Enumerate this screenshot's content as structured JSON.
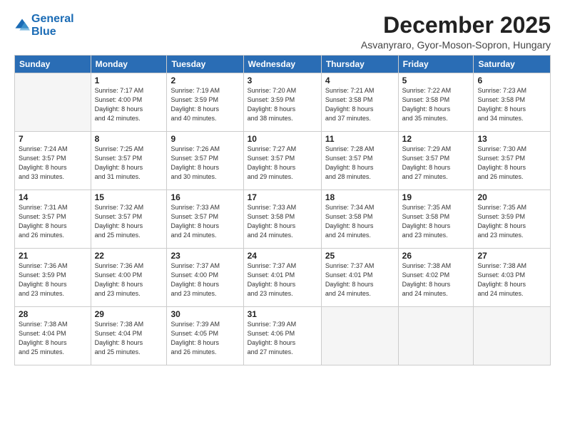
{
  "logo": {
    "line1": "General",
    "line2": "Blue"
  },
  "title": "December 2025",
  "location": "Asvanyraro, Gyor-Moson-Sopron, Hungary",
  "weekdays": [
    "Sunday",
    "Monday",
    "Tuesday",
    "Wednesday",
    "Thursday",
    "Friday",
    "Saturday"
  ],
  "weeks": [
    [
      {
        "day": "",
        "info": ""
      },
      {
        "day": "1",
        "info": "Sunrise: 7:17 AM\nSunset: 4:00 PM\nDaylight: 8 hours\nand 42 minutes."
      },
      {
        "day": "2",
        "info": "Sunrise: 7:19 AM\nSunset: 3:59 PM\nDaylight: 8 hours\nand 40 minutes."
      },
      {
        "day": "3",
        "info": "Sunrise: 7:20 AM\nSunset: 3:59 PM\nDaylight: 8 hours\nand 38 minutes."
      },
      {
        "day": "4",
        "info": "Sunrise: 7:21 AM\nSunset: 3:58 PM\nDaylight: 8 hours\nand 37 minutes."
      },
      {
        "day": "5",
        "info": "Sunrise: 7:22 AM\nSunset: 3:58 PM\nDaylight: 8 hours\nand 35 minutes."
      },
      {
        "day": "6",
        "info": "Sunrise: 7:23 AM\nSunset: 3:58 PM\nDaylight: 8 hours\nand 34 minutes."
      }
    ],
    [
      {
        "day": "7",
        "info": "Sunrise: 7:24 AM\nSunset: 3:57 PM\nDaylight: 8 hours\nand 33 minutes."
      },
      {
        "day": "8",
        "info": "Sunrise: 7:25 AM\nSunset: 3:57 PM\nDaylight: 8 hours\nand 31 minutes."
      },
      {
        "day": "9",
        "info": "Sunrise: 7:26 AM\nSunset: 3:57 PM\nDaylight: 8 hours\nand 30 minutes."
      },
      {
        "day": "10",
        "info": "Sunrise: 7:27 AM\nSunset: 3:57 PM\nDaylight: 8 hours\nand 29 minutes."
      },
      {
        "day": "11",
        "info": "Sunrise: 7:28 AM\nSunset: 3:57 PM\nDaylight: 8 hours\nand 28 minutes."
      },
      {
        "day": "12",
        "info": "Sunrise: 7:29 AM\nSunset: 3:57 PM\nDaylight: 8 hours\nand 27 minutes."
      },
      {
        "day": "13",
        "info": "Sunrise: 7:30 AM\nSunset: 3:57 PM\nDaylight: 8 hours\nand 26 minutes."
      }
    ],
    [
      {
        "day": "14",
        "info": "Sunrise: 7:31 AM\nSunset: 3:57 PM\nDaylight: 8 hours\nand 26 minutes."
      },
      {
        "day": "15",
        "info": "Sunrise: 7:32 AM\nSunset: 3:57 PM\nDaylight: 8 hours\nand 25 minutes."
      },
      {
        "day": "16",
        "info": "Sunrise: 7:33 AM\nSunset: 3:57 PM\nDaylight: 8 hours\nand 24 minutes."
      },
      {
        "day": "17",
        "info": "Sunrise: 7:33 AM\nSunset: 3:58 PM\nDaylight: 8 hours\nand 24 minutes."
      },
      {
        "day": "18",
        "info": "Sunrise: 7:34 AM\nSunset: 3:58 PM\nDaylight: 8 hours\nand 24 minutes."
      },
      {
        "day": "19",
        "info": "Sunrise: 7:35 AM\nSunset: 3:58 PM\nDaylight: 8 hours\nand 23 minutes."
      },
      {
        "day": "20",
        "info": "Sunrise: 7:35 AM\nSunset: 3:59 PM\nDaylight: 8 hours\nand 23 minutes."
      }
    ],
    [
      {
        "day": "21",
        "info": "Sunrise: 7:36 AM\nSunset: 3:59 PM\nDaylight: 8 hours\nand 23 minutes."
      },
      {
        "day": "22",
        "info": "Sunrise: 7:36 AM\nSunset: 4:00 PM\nDaylight: 8 hours\nand 23 minutes."
      },
      {
        "day": "23",
        "info": "Sunrise: 7:37 AM\nSunset: 4:00 PM\nDaylight: 8 hours\nand 23 minutes."
      },
      {
        "day": "24",
        "info": "Sunrise: 7:37 AM\nSunset: 4:01 PM\nDaylight: 8 hours\nand 23 minutes."
      },
      {
        "day": "25",
        "info": "Sunrise: 7:37 AM\nSunset: 4:01 PM\nDaylight: 8 hours\nand 24 minutes."
      },
      {
        "day": "26",
        "info": "Sunrise: 7:38 AM\nSunset: 4:02 PM\nDaylight: 8 hours\nand 24 minutes."
      },
      {
        "day": "27",
        "info": "Sunrise: 7:38 AM\nSunset: 4:03 PM\nDaylight: 8 hours\nand 24 minutes."
      }
    ],
    [
      {
        "day": "28",
        "info": "Sunrise: 7:38 AM\nSunset: 4:04 PM\nDaylight: 8 hours\nand 25 minutes."
      },
      {
        "day": "29",
        "info": "Sunrise: 7:38 AM\nSunset: 4:04 PM\nDaylight: 8 hours\nand 25 minutes."
      },
      {
        "day": "30",
        "info": "Sunrise: 7:39 AM\nSunset: 4:05 PM\nDaylight: 8 hours\nand 26 minutes."
      },
      {
        "day": "31",
        "info": "Sunrise: 7:39 AM\nSunset: 4:06 PM\nDaylight: 8 hours\nand 27 minutes."
      },
      {
        "day": "",
        "info": ""
      },
      {
        "day": "",
        "info": ""
      },
      {
        "day": "",
        "info": ""
      }
    ]
  ]
}
